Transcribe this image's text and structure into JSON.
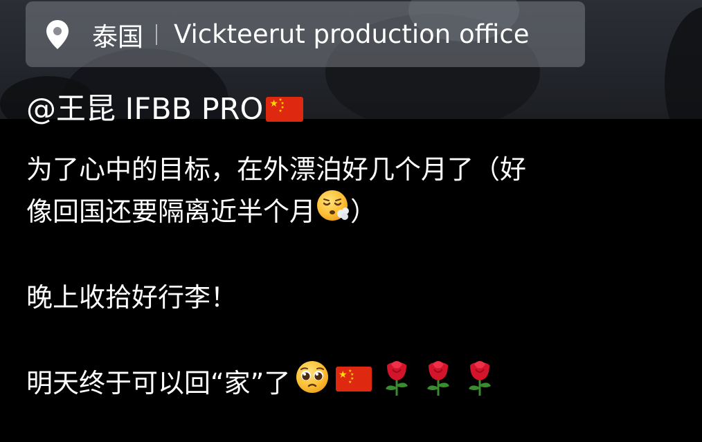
{
  "location": {
    "icon": "location-pin-icon",
    "country": "泰国",
    "place": "Vickteerut production office"
  },
  "author": {
    "handle": "@王昆 IFBB PRO",
    "flag": "china-flag-emoji"
  },
  "caption": {
    "line1": "为了心中的目标，在外漂泊好几个月了（好",
    "line2_text": "像回国还要隔离近半个月",
    "line2_emoji": "exhaling-face-emoji",
    "line2_end": "）",
    "line3": "晚上收拾好行李！",
    "line4_text": "明天终于可以回“家”了",
    "line4_emojis": [
      "pleading-face-emoji",
      "china-flag-emoji",
      "rose-emoji",
      "rose-emoji",
      "rose-emoji"
    ]
  },
  "colors": {
    "background": "#000000",
    "text": "#ffffff",
    "pill": "#787c84",
    "flag_red": "#de2910",
    "flag_star": "#ffde00",
    "rose_red": "#d4142a",
    "leaf_green": "#3a8d2e"
  }
}
